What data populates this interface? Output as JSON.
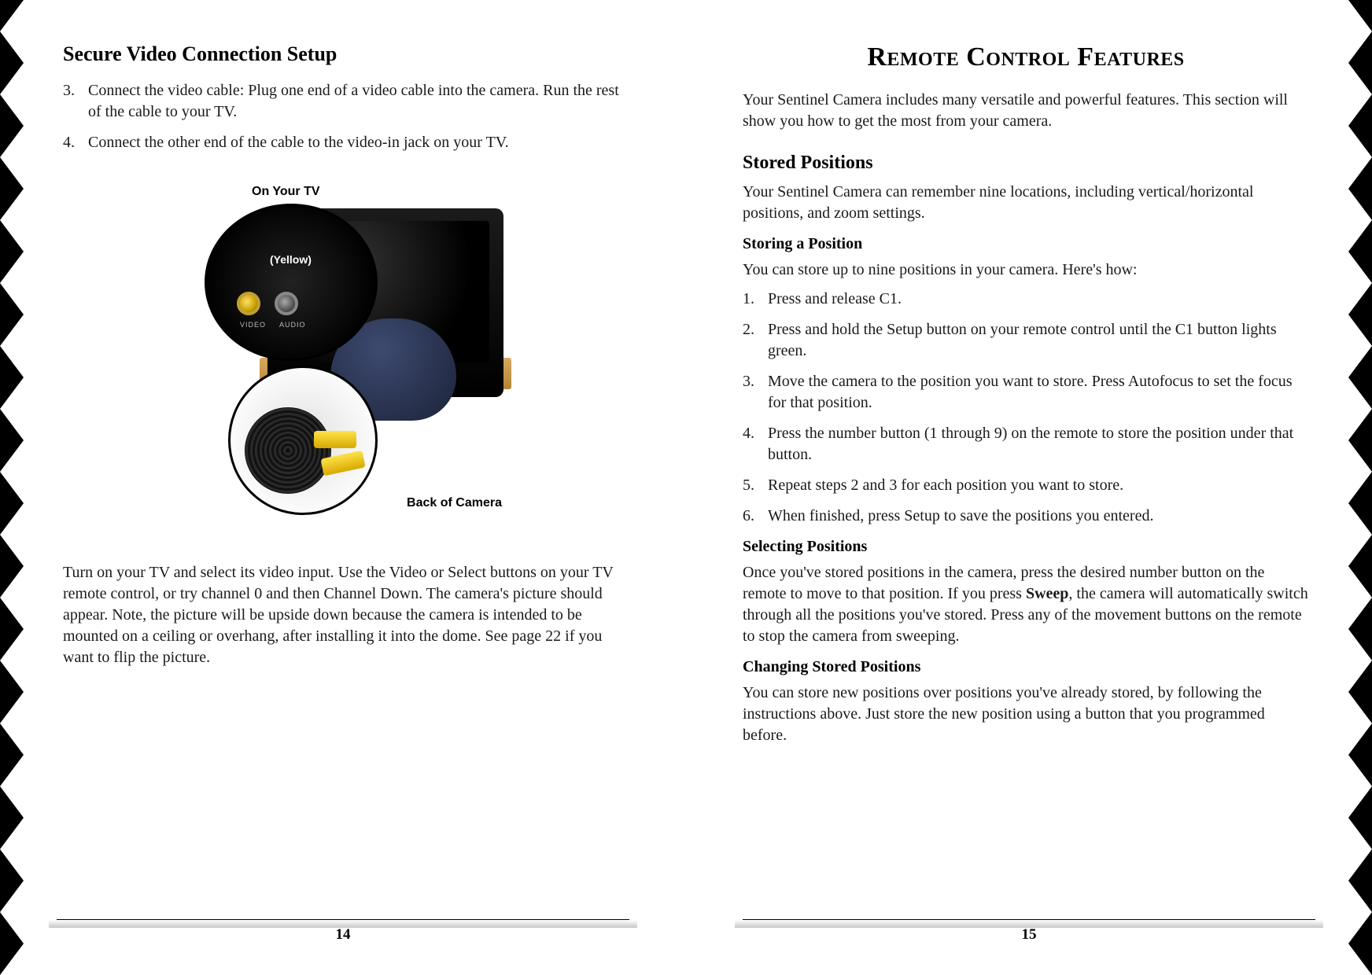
{
  "left": {
    "title": "Secure Video Connection Setup",
    "steps": [
      "Connect the video cable: Plug one end of a video cable into the camera. Run the rest of the cable to your TV.",
      "Connect the other end of the cable to the video-in jack on your TV."
    ],
    "figure": {
      "label_tv": "On Your TV",
      "label_yellow": "(Yellow)",
      "label_back": "Back of Camera",
      "port_video": "VIDEO",
      "port_audio": "AUDIO"
    },
    "bottom_para": "Turn on your TV and select its video input. Use the Video or Select buttons on your TV remote control, or try channel 0 and then Channel Down. The camera's picture should appear. Note, the picture will be upside down because the camera is intended to be mounted on a ceiling or overhang, after installing it into the dome. See page 22 if you want to flip the picture.",
    "page_num": "14"
  },
  "right": {
    "chapter": "Remote Control Features",
    "intro": "Your Sentinel Camera includes many versatile and powerful features. This section will show you how to get the most from your camera.",
    "stored_heading": "Stored Positions",
    "stored_intro": "Your Sentinel Camera can remember nine locations, including vertical/horizontal positions, and zoom settings.",
    "storing_heading": "Storing a Position",
    "storing_intro": "You can store up to nine positions in your camera. Here's how:",
    "storing_steps": [
      "Press and release C1.",
      "Press and hold the Setup button on your remote control until the C1 button lights green.",
      "Move the camera to the position you want to store. Press Autofocus to set the focus for that position.",
      "Press the number button (1 through 9) on the remote to store the position under that button.",
      "Repeat steps 2 and 3 for each position you want to store.",
      "When finished, press Setup to save the positions you entered."
    ],
    "selecting_heading": "Selecting Positions",
    "selecting_para_a": "Once you've stored positions in the camera, press the desired number button on the remote to move to that position. If you press ",
    "selecting_sweep": "Sweep",
    "selecting_para_b": ", the camera will automatically switch through all the positions you've stored. Press any of the movement buttons on the remote to stop the camera from sweeping.",
    "changing_heading": "Changing Stored Positions",
    "changing_para": "You can store new positions over positions you've already stored, by following the instructions above. Just store the new position using a button that you programmed before.",
    "page_num": "15"
  }
}
